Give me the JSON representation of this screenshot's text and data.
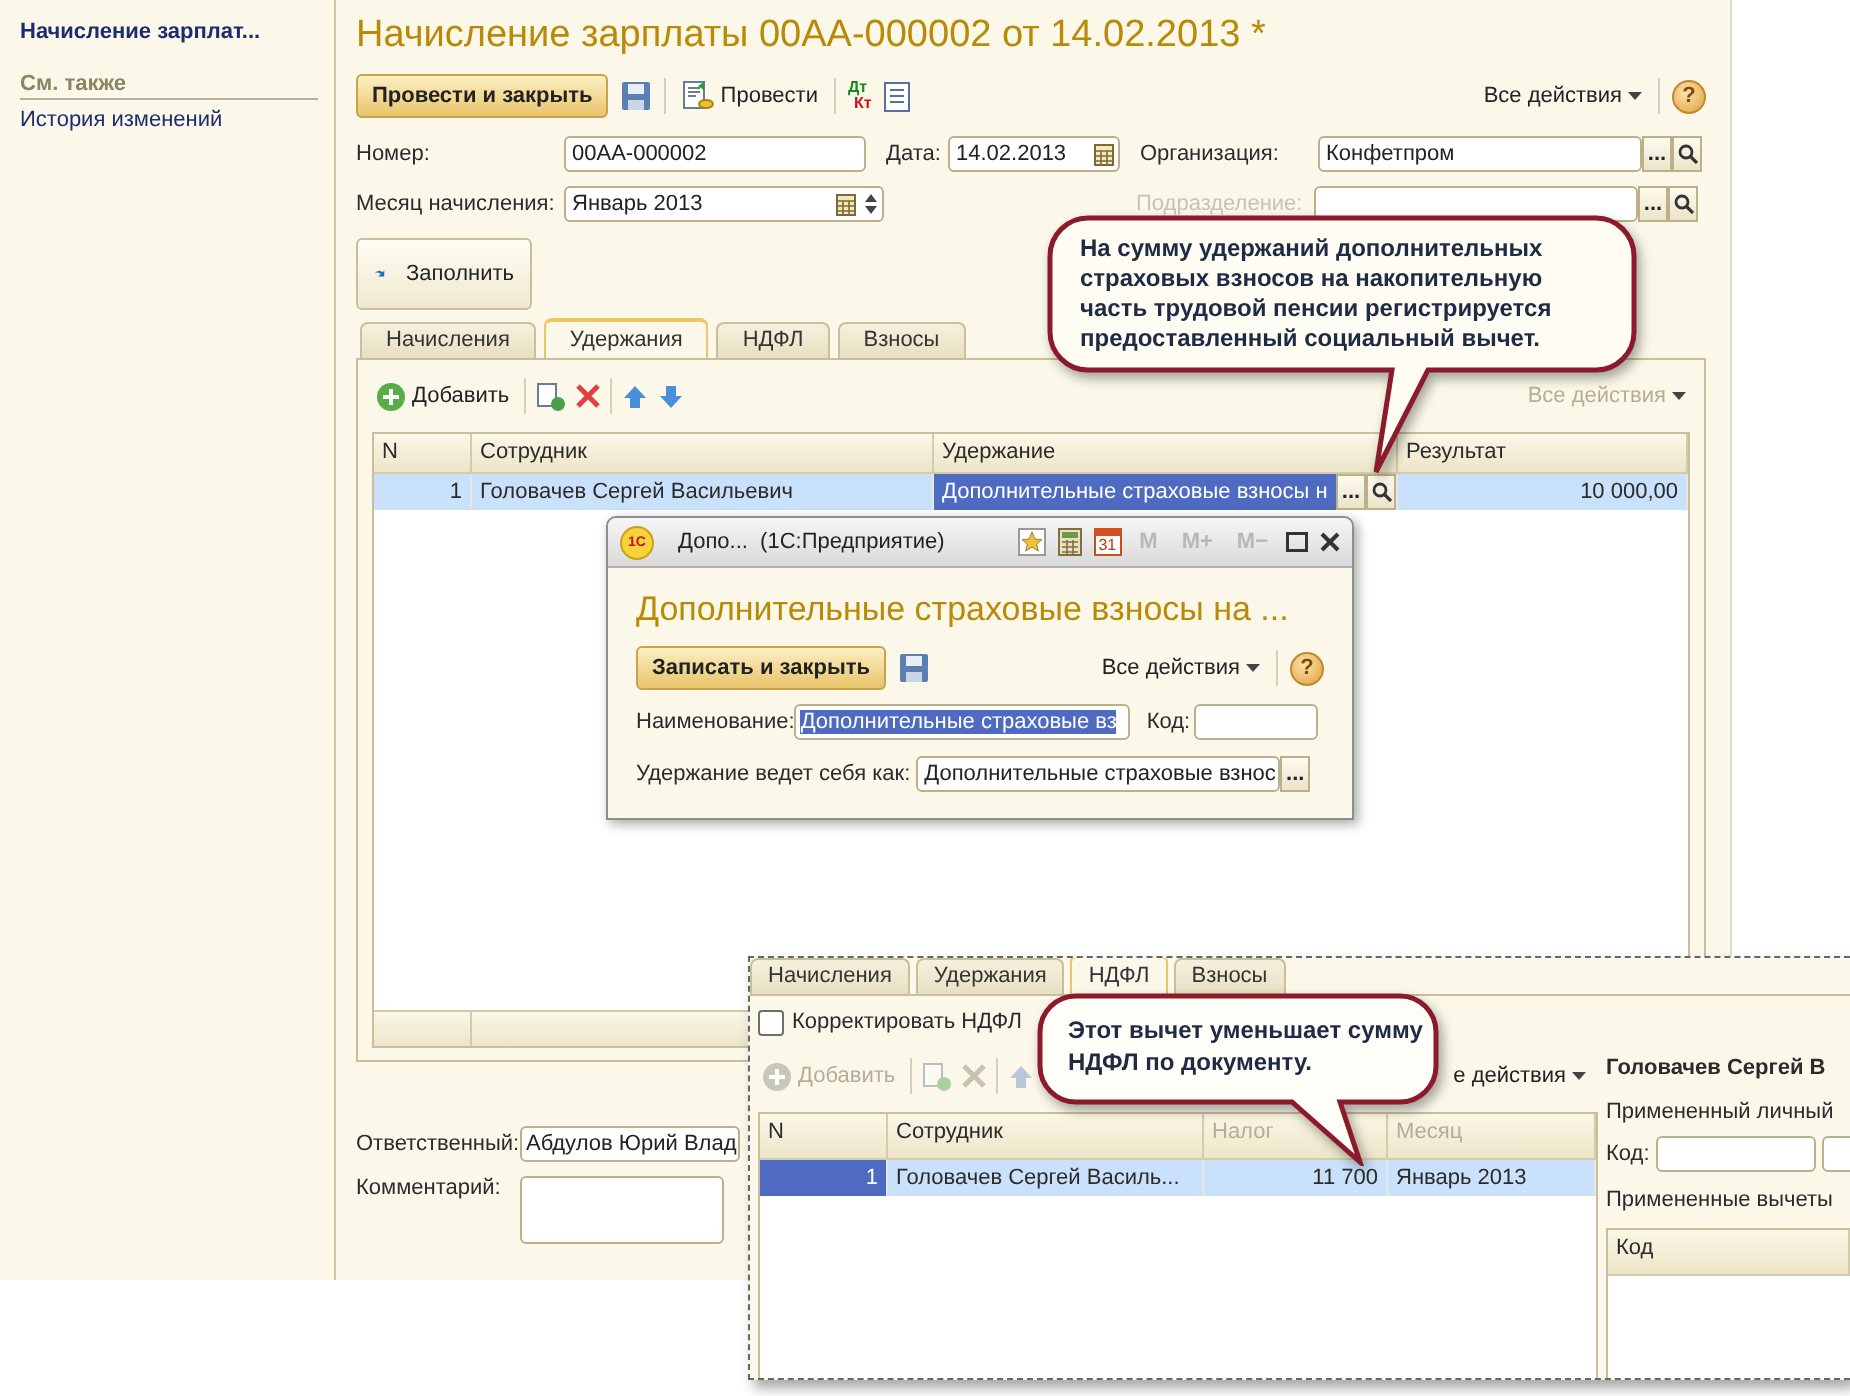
{
  "sidebar": {
    "title": "Начисление зарплат...",
    "see_also": "См. также",
    "links": [
      "История изменений"
    ]
  },
  "document": {
    "title": "Начисление зарплаты 00АА-000002 от 14.02.2013 *",
    "toolbar": {
      "post_close": "Провести и закрыть",
      "post": "Провести",
      "dt": "Дт",
      "kt": "Кт",
      "all_actions": "Все действия",
      "help": "?"
    },
    "number": {
      "label": "Номер:",
      "value": "00АА-000002"
    },
    "date": {
      "label": "Дата:",
      "value": "14.02.2013"
    },
    "organization": {
      "label": "Организация:",
      "value": "Конфетпром",
      "choice": "..."
    },
    "month": {
      "label": "Месяц начисления:",
      "value": "Январь 2013"
    },
    "subdivision": {
      "label": "Подразделение:",
      "disabled": true,
      "choice": "..."
    },
    "fill_button": "Заполнить",
    "tabs": [
      {
        "label": "Начисления",
        "selected": false
      },
      {
        "label": "Удержания",
        "selected": true
      },
      {
        "label": "НДФЛ",
        "selected": false
      },
      {
        "label": "Взносы",
        "selected": false
      }
    ],
    "table_toolbar": {
      "add": "Добавить",
      "all_actions": "Все действия"
    },
    "table": {
      "columns": [
        "N",
        "Сотрудник",
        "Удержание",
        "Результат"
      ],
      "rows": [
        {
          "n": "1",
          "employee": "Головачев Сергей Васильевич",
          "deduction": "Дополнительные страховые взносы н",
          "choice": "...",
          "result": "10 000,00",
          "selected": true
        }
      ]
    },
    "responsible": {
      "label": "Ответственный:",
      "value": "Абдулов Юрий Влад"
    },
    "comment": {
      "label": "Комментарий:"
    }
  },
  "dialog": {
    "logo": "1С",
    "title": "Допо...  (1С:Предприятие)",
    "calendar_day": "31",
    "memory_buttons": [
      "M",
      "M+",
      "M−"
    ],
    "memory_disabled": true,
    "heading": "Дополнительные страховые взносы на ...",
    "save_close": "Записать и закрыть",
    "all_actions": "Все действия",
    "help": "?",
    "name": {
      "label": "Наименование:",
      "value": "Дополнительные страховые вз"
    },
    "code": {
      "label": "Код:"
    },
    "behaves": {
      "label": "Удержание ведет себя как:",
      "value": "Дополнительные страховые взнос",
      "choice": "..."
    }
  },
  "inset": {
    "tabs": [
      {
        "label": "Начисления",
        "selected": false
      },
      {
        "label": "Удержания",
        "selected": false
      },
      {
        "label": "НДФЛ",
        "selected": true
      },
      {
        "label": "Взносы",
        "selected": false
      }
    ],
    "checkbox": {
      "label": "Корректировать НДФЛ",
      "checked": false
    },
    "toolbar": {
      "add": "Добавить",
      "all_actions": "е действия",
      "disabled": true
    },
    "table": {
      "columns": [
        "N",
        "Сотрудник",
        "Налог",
        "Месяц"
      ],
      "rows": [
        {
          "n": "1",
          "employee": "Головачев Сергей Василь...",
          "tax": "11 700",
          "month": "Январь 2013",
          "selected": true
        }
      ]
    },
    "side": {
      "employee": "Головачев Сергей В",
      "personal_label": "Примененный личный",
      "code_label": "Код:",
      "deductions_label": "Примененные вычеты",
      "columns": [
        "Код"
      ]
    }
  },
  "callouts": [
    {
      "text": "На сумму удержаний дополнительных страховых взносов на накопительную часть трудовой пенсии регистрируется предоставленный социальный вычет."
    },
    {
      "text": "Этот вычет уменьшает сумму НДФЛ по документу."
    }
  ]
}
